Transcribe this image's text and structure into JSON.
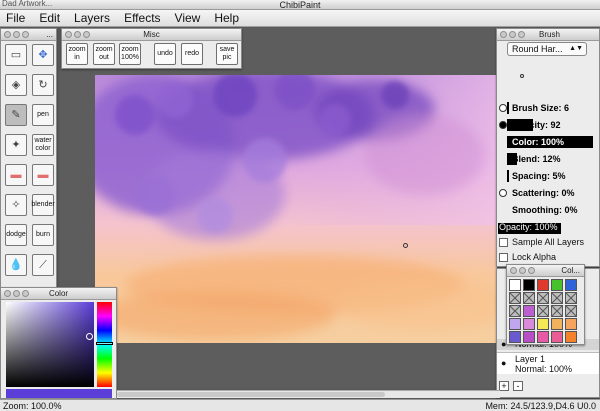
{
  "app": {
    "title": "ChibiPaint",
    "behind_title": "Dad Artwork..."
  },
  "menu": [
    "File",
    "Edit",
    "Layers",
    "Effects",
    "View",
    "Help"
  ],
  "misc": {
    "title": "Misc",
    "buttons": [
      "zoom in",
      "zoom out",
      "zoom 100%",
      "undo",
      "redo",
      "save pic"
    ]
  },
  "tools": {
    "title": "...",
    "items": [
      {
        "name": "rect-select",
        "label": ""
      },
      {
        "name": "move",
        "label": ""
      },
      {
        "name": "fill",
        "label": ""
      },
      {
        "name": "rotate",
        "label": ""
      },
      {
        "name": "pencil",
        "label": ""
      },
      {
        "name": "pen",
        "label": "pen"
      },
      {
        "name": "airbrush",
        "label": ""
      },
      {
        "name": "watercolor",
        "label": "water color"
      },
      {
        "name": "eraser",
        "label": ""
      },
      {
        "name": "soft-eraser",
        "label": ""
      },
      {
        "name": "smudge",
        "label": ""
      },
      {
        "name": "blender",
        "label": "blender"
      },
      {
        "name": "dodge",
        "label": "dodge"
      },
      {
        "name": "burn",
        "label": "burn"
      },
      {
        "name": "blur",
        "label": ""
      },
      {
        "name": "eyedropper",
        "label": ""
      }
    ]
  },
  "brush": {
    "title": "Brush",
    "preset": "Round Har...",
    "rows": [
      {
        "label": "Brush Size: 6",
        "fill": 0.02,
        "radio": "empty"
      },
      {
        "label": "Opacity: 92",
        "fill": 0.3,
        "radio": "full"
      },
      {
        "label": "Color: 100%",
        "fill": 1.0,
        "radio": ""
      },
      {
        "label": "Blend: 12%",
        "fill": 0.12,
        "radio": ""
      },
      {
        "label": "Spacing: 5%",
        "fill": 0.02,
        "radio": ""
      },
      {
        "label": "Scattering: 0%",
        "fill": 0,
        "radio": "empty"
      },
      {
        "label": "Smoothing: 0%",
        "fill": 0,
        "radio": ""
      }
    ],
    "opacity_bar": "Opacity: 100%",
    "sample_all": "Sample All Layers",
    "lock_alpha": "Lock Alpha"
  },
  "layers": {
    "blend_partial": "Normal: 100%",
    "name": "Layer 1",
    "mode": "Normal: 100%"
  },
  "swatches": {
    "title": "Col...",
    "colors": [
      "#ffffff",
      "#000000",
      "#e03a2f",
      "#48c22c",
      "#2f63d8",
      "x",
      "x",
      "x",
      "x",
      "x",
      "x",
      "#bb5fd1",
      "x",
      "x",
      "x",
      "#bfa6ee",
      "#d98ad9",
      "#f4ea55",
      "#f2b25b",
      "#f5a45d",
      "#6a5ad0",
      "#b94fc7",
      "#e65aa7",
      "#e95c96",
      "#f3822b"
    ]
  },
  "color": {
    "title": "Color",
    "hue_color": "#5b3ed8"
  },
  "status": {
    "zoom": "Zoom: 100.0%",
    "mem": "Mem: 24.5/123.9,D4.6 U0.0"
  },
  "accent": "#2f63d8"
}
